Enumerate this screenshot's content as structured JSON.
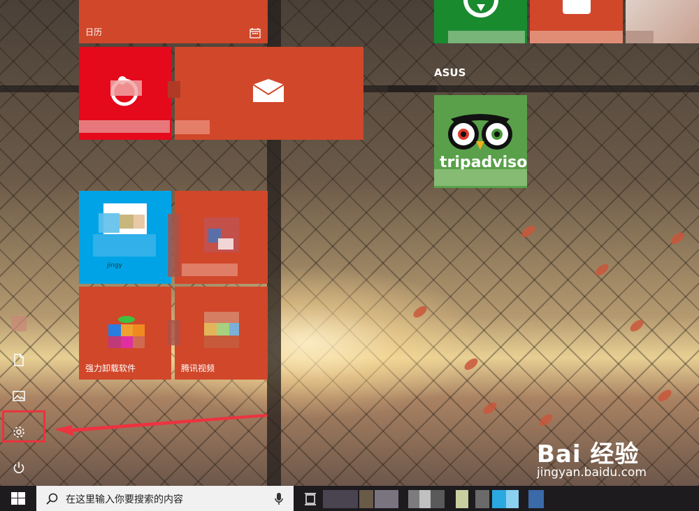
{
  "tiles": {
    "calendar_label": "日历",
    "uninstaller_label": "强力卸载软件",
    "video_label": "腾讯视频",
    "blue_tile_caption": "jingy",
    "tripadvisor_text": "tripadvisor"
  },
  "groups": {
    "asus_title": "ASUS"
  },
  "taskbar": {
    "search_placeholder": "在这里输入你要搜索的内容"
  },
  "watermark": {
    "main": "Bai 经验",
    "sub": "jingyan.baidu.com"
  },
  "colors": {
    "tile_orange": "#d1472a",
    "tile_red": "#e5091c",
    "tile_blue": "#00a4e6",
    "tile_green": "#1a8a2f",
    "highlight": "#e9343d",
    "taskbar": "#1e1b1f"
  }
}
